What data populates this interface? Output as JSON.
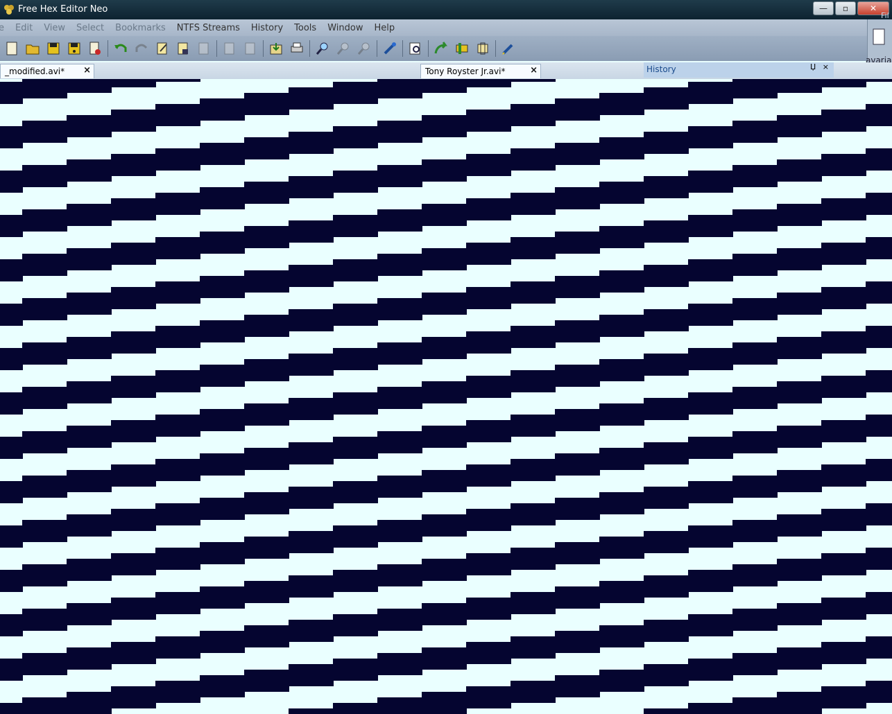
{
  "window": {
    "title": "Free Hex Editor Neo",
    "controls": {
      "minimize": "—",
      "maximize": "▫",
      "close": "✕"
    }
  },
  "menu": {
    "items": [
      {
        "label": "e",
        "dim": true
      },
      {
        "label": "Edit",
        "dim": true
      },
      {
        "label": "View",
        "dim": true
      },
      {
        "label": "Select",
        "dim": true
      },
      {
        "label": "Bookmarks",
        "dim": true
      },
      {
        "label": "NTFS Streams",
        "dim": false
      },
      {
        "label": "History",
        "dim": false
      },
      {
        "label": "Tools",
        "dim": false
      },
      {
        "label": "Window",
        "dim": false
      },
      {
        "label": "Help",
        "dim": false
      }
    ]
  },
  "toolbar": {
    "icons": [
      "new-file-icon",
      "open-folder-icon",
      "save-icon",
      "save-as-icon",
      "close-file-icon",
      "separator",
      "undo-icon",
      "redo-icon",
      "edit-document-icon",
      "save-document-icon",
      "save-all-icon",
      "separator",
      "edit-disabled-icon",
      "save-disabled-icon",
      "separator",
      "export-icon",
      "print-icon",
      "separator",
      "find-icon",
      "find-next-icon",
      "find-previous-icon",
      "separator",
      "tools-icon",
      "separator",
      "inspect-icon",
      "separator",
      "go-to-icon",
      "bookmark-icon",
      "fill-icon",
      "separator",
      "pencil-icon"
    ]
  },
  "tabs": [
    {
      "label": "_modified.avi*",
      "close": "×"
    },
    {
      "label": "Tony Royster Jr.avi*",
      "close": "×"
    }
  ],
  "history_pane": {
    "title": "History",
    "pin": "Џ",
    "close": "×"
  },
  "right_edge": {
    "text": "avaria",
    "fil": "Fil"
  },
  "colors": {
    "stripe_dark": "#050530",
    "stripe_light": "#eaffff",
    "title_bar": "#13303f"
  }
}
